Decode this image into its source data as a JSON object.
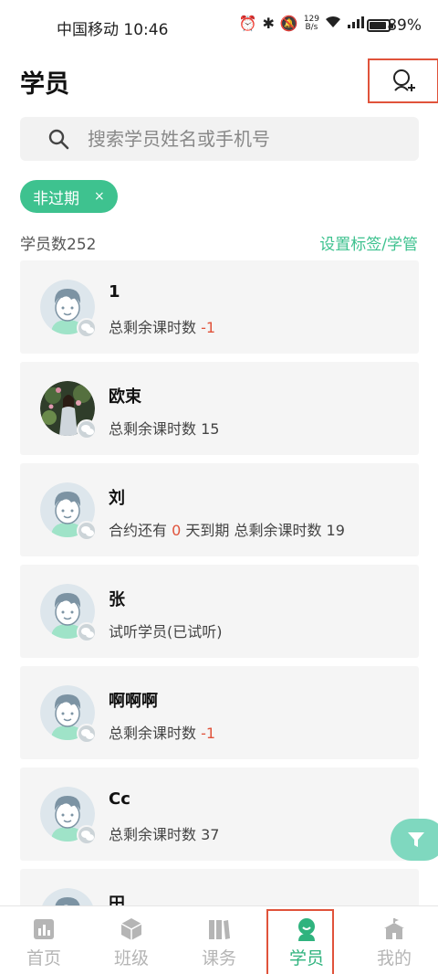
{
  "status_bar": {
    "carrier_time": "中国移动 10:46",
    "net_speed_top": "129",
    "net_speed_bottom": "B/s",
    "signal_type": "5G",
    "battery_pct": "89%",
    "battery_level": 0.89
  },
  "header": {
    "title": "学员",
    "add_icon": "add-user-icon"
  },
  "search": {
    "placeholder": "搜索学员姓名或手机号",
    "icon": "search-icon"
  },
  "filter_chip": {
    "label": "非过期",
    "close": "×"
  },
  "summary": {
    "count_label": "学员数252",
    "settings_link": "设置标签/学管"
  },
  "students": [
    {
      "name": "1",
      "sub_prefix": "总剩余课时数 ",
      "sub_highlight": "-1",
      "sub_suffix": "",
      "avatar": "default-avatar"
    },
    {
      "name": "欧束",
      "sub_prefix": "总剩余课时数 15",
      "sub_highlight": "",
      "sub_suffix": "",
      "avatar": "photo-avatar"
    },
    {
      "name": "刘",
      "sub_prefix": "合约还有 ",
      "sub_highlight": "0",
      "sub_suffix": " 天到期 总剩余课时数 19",
      "avatar": "default-avatar"
    },
    {
      "name": "张",
      "sub_prefix": "试听学员(已试听)",
      "sub_highlight": "",
      "sub_suffix": "",
      "avatar": "default-avatar"
    },
    {
      "name": "啊啊啊",
      "sub_prefix": "总剩余课时数 ",
      "sub_highlight": "-1",
      "sub_suffix": "",
      "avatar": "default-avatar"
    },
    {
      "name": "Cc",
      "sub_prefix": "总剩余课时数 37",
      "sub_highlight": "",
      "sub_suffix": "",
      "avatar": "default-avatar"
    },
    {
      "name": "田",
      "sub_prefix": "",
      "sub_highlight": "",
      "sub_suffix": "",
      "avatar": "default-avatar"
    }
  ],
  "bottom_nav": [
    {
      "label": "首页",
      "icon": "chart-icon",
      "active": false
    },
    {
      "label": "班级",
      "icon": "cube-icon",
      "active": false
    },
    {
      "label": "课务",
      "icon": "books-icon",
      "active": false
    },
    {
      "label": "学员",
      "icon": "student-icon",
      "active": true
    },
    {
      "label": "我的",
      "icon": "school-icon",
      "active": false
    }
  ],
  "colors": {
    "accent": "#3ec28f",
    "highlight": "#e0533b",
    "card_bg": "#f5f5f5"
  }
}
